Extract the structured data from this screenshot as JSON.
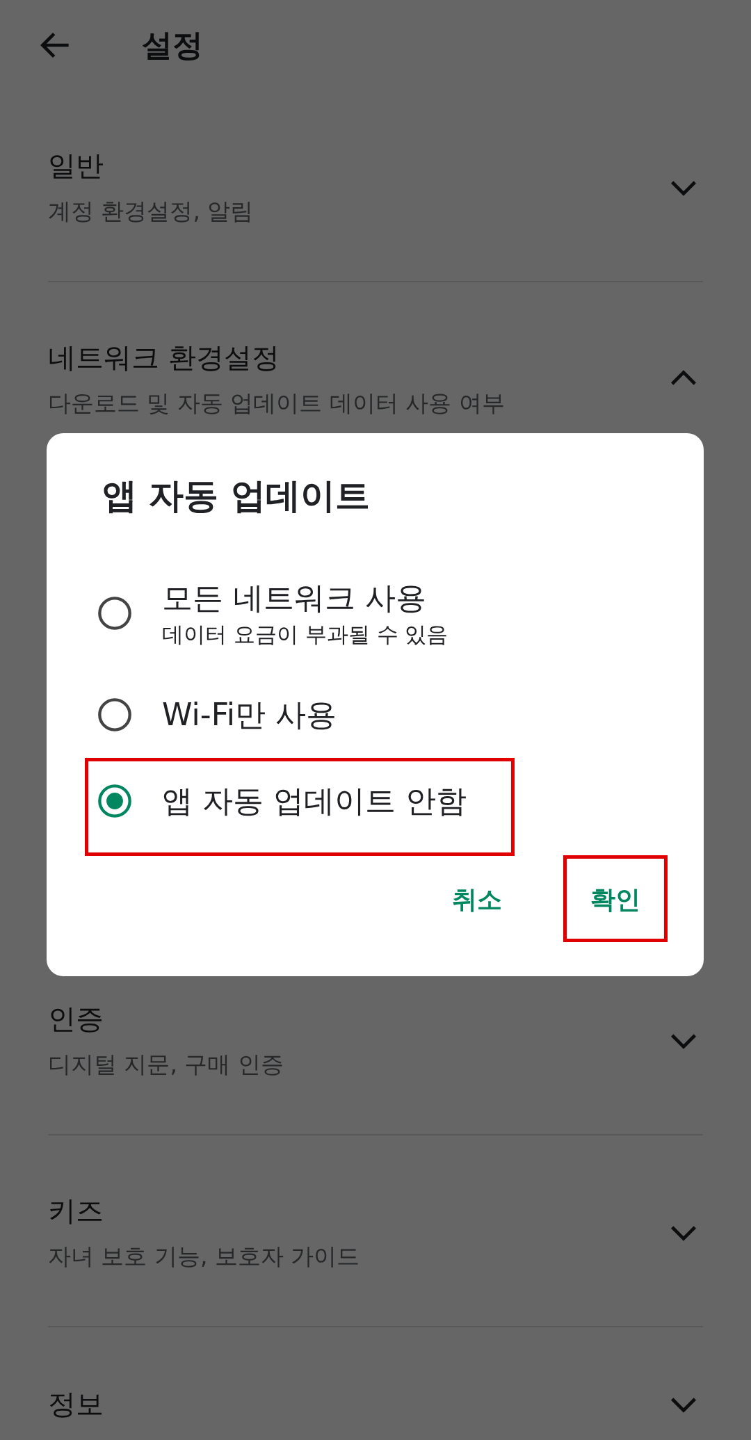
{
  "header": {
    "title": "설정"
  },
  "sections": [
    {
      "title": "일반",
      "subtitle": "계정 환경설정, 알림",
      "expanded": false
    },
    {
      "title": "네트워크 환경설정",
      "subtitle": "다운로드 및 자동 업데이트 데이터 사용 여부",
      "expanded": true
    },
    {
      "title": "인증",
      "subtitle": "디지털 지문, 구매 인증",
      "expanded": false
    },
    {
      "title": "키즈",
      "subtitle": "자녀 보호 기능, 보호자 가이드",
      "expanded": false
    },
    {
      "title": "정보",
      "expanded": false
    }
  ],
  "dialog": {
    "title": "앱 자동 업데이트",
    "options": [
      {
        "label": "모든 네트워크 사용",
        "description": "데이터 요금이 부과될 수 있음",
        "selected": false,
        "highlighted": false
      },
      {
        "label": "Wi-Fi만 사용",
        "selected": false,
        "highlighted": false
      },
      {
        "label": "앱 자동 업데이트 안함",
        "selected": true,
        "highlighted": true
      }
    ],
    "buttons": [
      {
        "label": "취소",
        "highlighted": false
      },
      {
        "label": "확인",
        "highlighted": true
      }
    ]
  }
}
